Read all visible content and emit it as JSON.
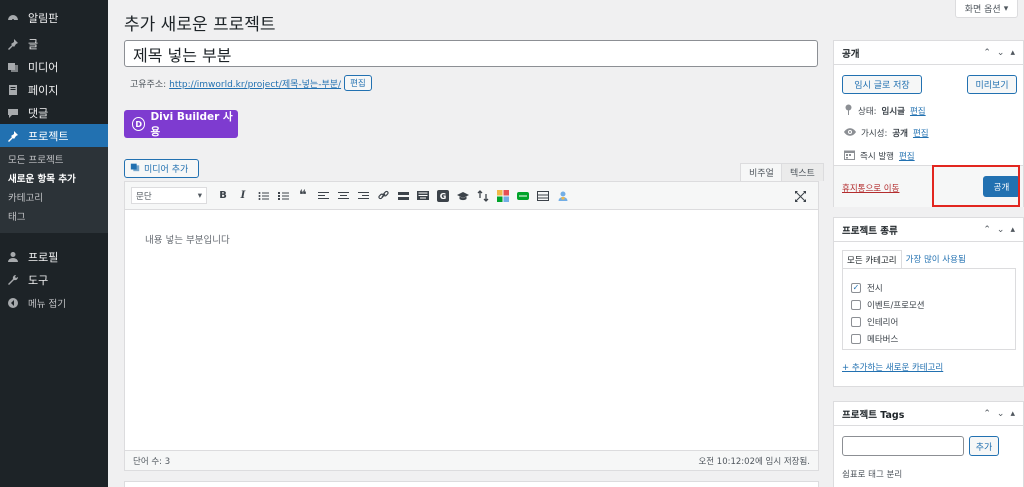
{
  "sidebar": {
    "items": [
      {
        "label": "알림판",
        "icon": "dashboard-icon"
      },
      {
        "label": "글",
        "icon": "pin-icon"
      },
      {
        "label": "미디어",
        "icon": "media-icon"
      },
      {
        "label": "페이지",
        "icon": "page-icon"
      },
      {
        "label": "댓글",
        "icon": "comment-icon"
      },
      {
        "label": "프로젝트",
        "icon": "pin-icon"
      }
    ],
    "submenu": [
      "모든 프로젝트",
      "새로운 항목 추가",
      "카테고리",
      "태그"
    ],
    "items_after": [
      {
        "label": "프로필",
        "icon": "user-icon"
      },
      {
        "label": "도구",
        "icon": "wrench-icon"
      },
      {
        "label": "메뉴 접기",
        "icon": "collapse-icon"
      }
    ]
  },
  "header": {
    "title": "추가 새로운 프로젝트",
    "screen_options": "화면 옵션"
  },
  "post": {
    "title_value": "제목 넣는 부분",
    "permalink_label": "고유주소:",
    "permalink_url": "http://imworld.kr/project/제목-넣는-부분/",
    "edit_label": "편집"
  },
  "divi": {
    "label": "Divi Builder 사용",
    "logo_letter": "D"
  },
  "editor": {
    "add_media": "미디어 추가",
    "tab_visual": "비주얼",
    "tab_text": "텍스트",
    "format_select": "문단",
    "content": "내용 넣는 부분입니다",
    "word_count": "단어 수: 3",
    "saved_status": "오전 10:12:02에 임시 저장됨."
  },
  "publish": {
    "title": "공개",
    "save_draft": "임시 글로 저장",
    "preview": "미리보기",
    "status_label": "상태:",
    "status_value": "임시글",
    "visibility_label": "가시성:",
    "visibility_value": "공개",
    "schedule_label": "즉시 발행",
    "edit": "편집",
    "trash": "휴지통으로 이동",
    "publish_button": "공개"
  },
  "categories": {
    "title": "프로젝트 종류",
    "tab_all": "모든 카테고리",
    "tab_popular": "가장 많이 사용됨",
    "items": [
      {
        "label": "전시",
        "checked": true
      },
      {
        "label": "이벤트/프로모션",
        "checked": false
      },
      {
        "label": "인테리어",
        "checked": false
      },
      {
        "label": "메타버스",
        "checked": false
      }
    ],
    "add_new": "+ 추가하는 새로운 카테고리"
  },
  "tags": {
    "title": "프로젝트 Tags",
    "add_button": "추가",
    "hint": "쉼표로 태그 분리"
  },
  "colors": {
    "accent": "#2271b1",
    "sidebar_bg": "#1d2327",
    "divi_purple": "#7e3bd0",
    "highlight_red": "#e2261f",
    "trash_red": "#b32d2e"
  }
}
